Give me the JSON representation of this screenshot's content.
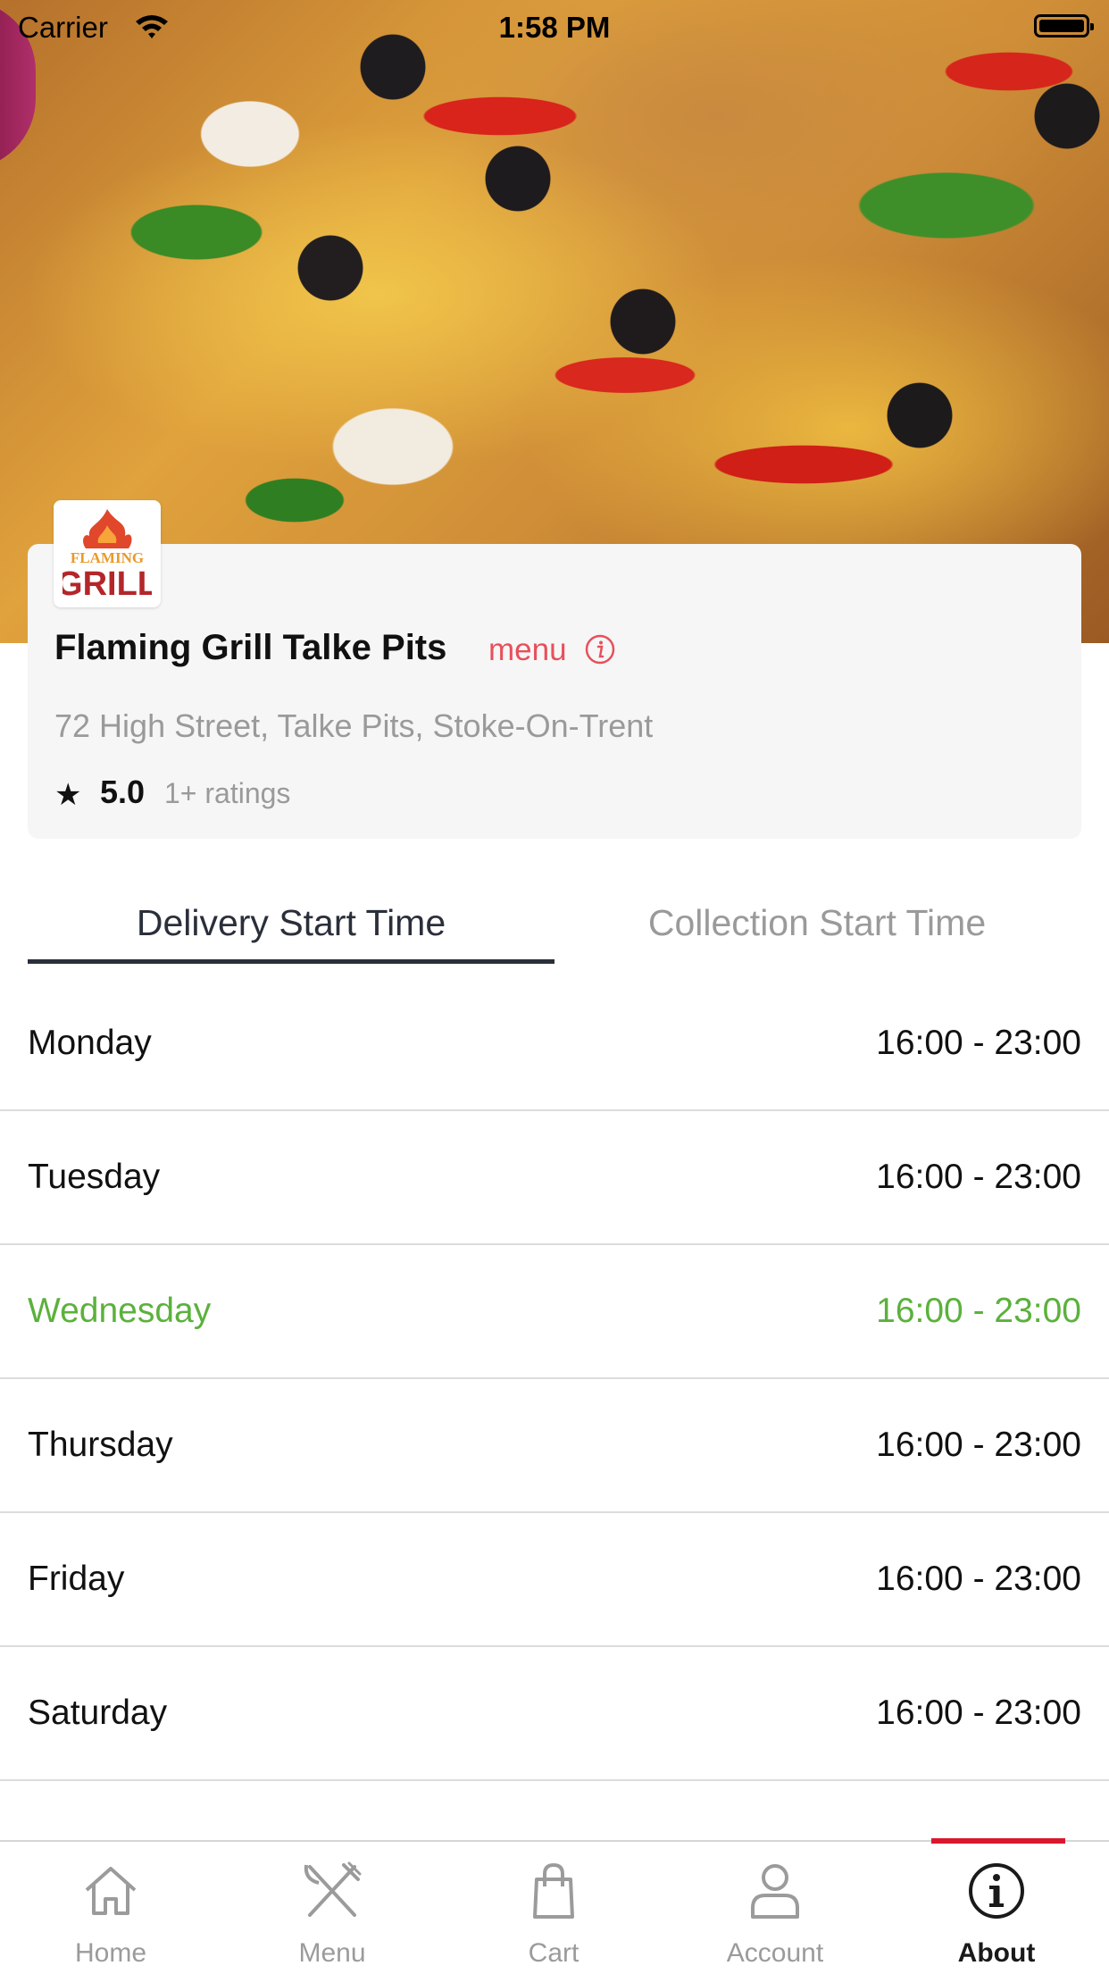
{
  "status_bar": {
    "carrier": "Carrier",
    "time": "1:58 PM",
    "icons": [
      "wifi-icon",
      "battery-icon"
    ]
  },
  "store": {
    "logo_text": "FLAMING GRILL",
    "name": "Flaming Grill Talke Pits",
    "menu_link": "menu",
    "address": "72 High Street, Talke Pits, Stoke-On-Trent",
    "rating": "5.0",
    "rating_count": "1+ ratings"
  },
  "tabs": [
    {
      "label": "Delivery Start Time",
      "active": true
    },
    {
      "label": "Collection Start Time",
      "active": false
    }
  ],
  "hours": [
    {
      "day": "Monday",
      "time": "16:00 - 23:00"
    },
    {
      "day": "Tuesday",
      "time": "16:00 - 23:00"
    },
    {
      "day": "Wednesday",
      "time": "16:00 - 23:00",
      "today": true
    },
    {
      "day": "Thursday",
      "time": "16:00 - 23:00"
    },
    {
      "day": "Friday",
      "time": "16:00 - 23:00"
    },
    {
      "day": "Saturday",
      "time": "16:00 - 23:00"
    }
  ],
  "tab_bar": {
    "items": [
      {
        "label": "Home",
        "icon": "home-icon"
      },
      {
        "label": "Menu",
        "icon": "fork-knife-icon"
      },
      {
        "label": "Cart",
        "icon": "shopping-bag-icon"
      },
      {
        "label": "Account",
        "icon": "person-icon"
      },
      {
        "label": "About",
        "icon": "info-circle-icon",
        "active": true
      }
    ]
  },
  "colors": {
    "accent": "#e8505b",
    "today": "#5bb13c",
    "tab_indicator": "#d9182d",
    "active_tab_underline": "#2a2f3a"
  }
}
